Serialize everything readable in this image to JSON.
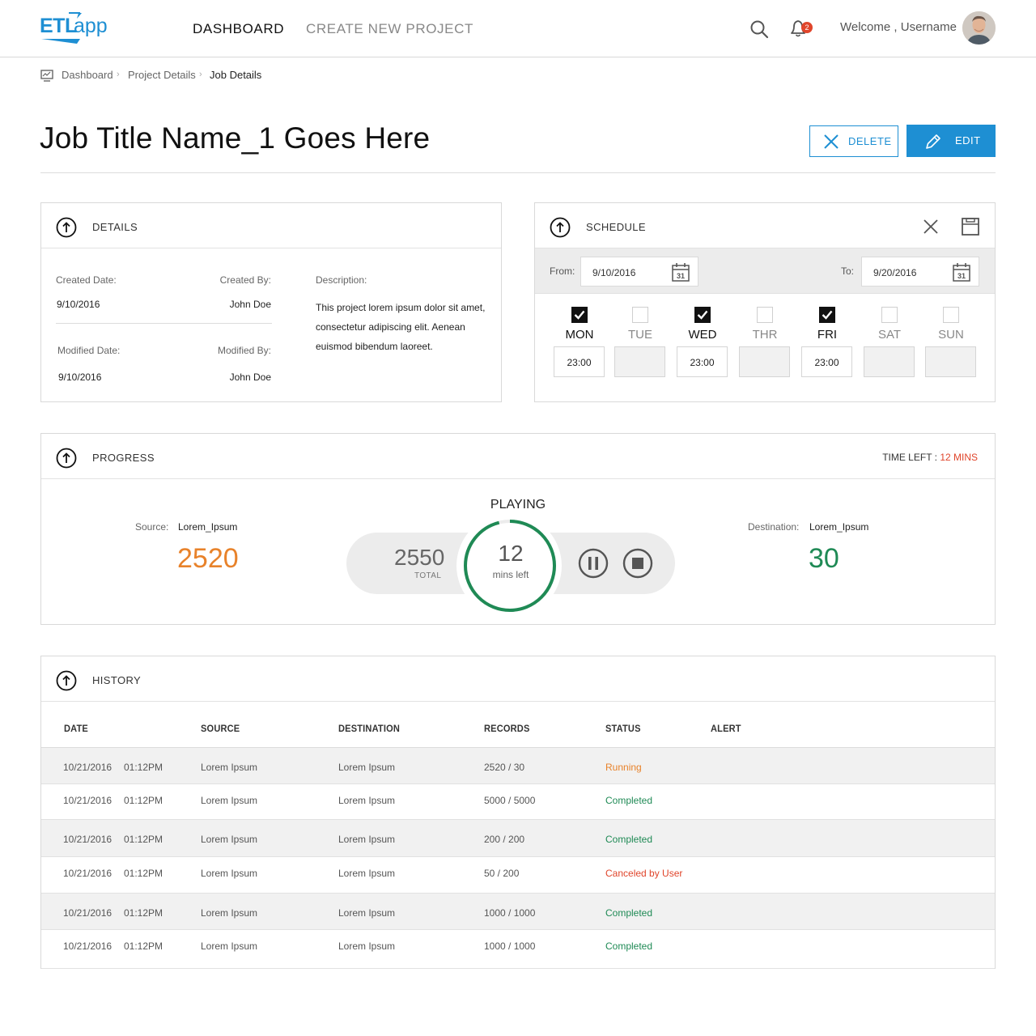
{
  "header": {
    "logo_text_a": "ETL",
    "logo_text_b": "app",
    "nav": [
      {
        "label": "DASHBOARD",
        "active": true
      },
      {
        "label": "CREATE NEW PROJECT",
        "active": false
      }
    ],
    "notification_count": "2",
    "welcome": "Welcome , Username",
    "icons": {
      "search": "search-icon",
      "bell": "bell-icon",
      "avatar": "user-avatar"
    }
  },
  "breadcrumb": {
    "items": [
      "Dashboard",
      "Project Details",
      "Job Details"
    ],
    "separator": "›"
  },
  "page": {
    "title": "Job Title Name_1 Goes Here",
    "delete_label": "DELETE",
    "edit_label": "EDIT"
  },
  "details": {
    "title": "DETAILS",
    "created_date_label": "Created Date:",
    "created_date": "9/10/2016",
    "created_by_label": "Created By:",
    "created_by": "John Doe",
    "modified_date_label": "Modified Date:",
    "modified_date": "9/10/2016",
    "modified_by_label": "Modified By:",
    "modified_by": "John Doe",
    "description_label": "Description:",
    "description": "This project lorem ipsum dolor sit amet, consectetur adipiscing elit. Aenean euismod bibendum laoreet."
  },
  "schedule": {
    "title": "SCHEDULE",
    "from_label": "From:",
    "from_value": "9/10/2016",
    "to_label": "To:",
    "to_value": "9/20/2016",
    "calendar_day": "31",
    "days": [
      {
        "name": "MON",
        "checked": true,
        "time": "23:00"
      },
      {
        "name": "TUE",
        "checked": false,
        "time": ""
      },
      {
        "name": "WED",
        "checked": true,
        "time": "23:00"
      },
      {
        "name": "THR",
        "checked": false,
        "time": ""
      },
      {
        "name": "FRI",
        "checked": true,
        "time": "23:00"
      },
      {
        "name": "SAT",
        "checked": false,
        "time": ""
      },
      {
        "name": "SUN",
        "checked": false,
        "time": ""
      }
    ]
  },
  "progress": {
    "title": "PROGRESS",
    "time_left_label": "TIME LEFT : ",
    "time_left_value": "12 MINS",
    "state": "PLAYING",
    "source_label": "Source:",
    "source_name": "Lorem_Ipsum",
    "source_count": "2520",
    "destination_label": "Destination:",
    "destination_name": "Lorem_Ipsum",
    "destination_count": "30",
    "total": "2550",
    "total_label": "TOTAL",
    "minutes_left": "12",
    "minutes_left_label": "mins left",
    "ring_fraction": 0.96,
    "colors": {
      "source": "#e8822a",
      "destination": "#1f8a55",
      "ring": "#1f8a55",
      "accent": "#1e8fd3",
      "alert": "#e0452b"
    }
  },
  "history": {
    "title": "HISTORY",
    "columns": [
      "DATE",
      "SOURCE",
      "DESTINATION",
      "RECORDS",
      "STATUS",
      "ALERT"
    ],
    "rows": [
      {
        "date": "10/21/2016",
        "time": "01:12PM",
        "source": "Lorem Ipsum",
        "destination": "Lorem Ipsum",
        "records": "2520 / 30",
        "status": "Running",
        "status_type": "running",
        "alert": ""
      },
      {
        "date": "10/21/2016",
        "time": "01:12PM",
        "source": "Lorem Ipsum",
        "destination": "Lorem Ipsum",
        "records": "5000 / 5000",
        "status": "Completed",
        "status_type": "completed",
        "alert": ""
      },
      {
        "date": "10/21/2016",
        "time": "01:12PM",
        "source": "Lorem Ipsum",
        "destination": "Lorem Ipsum",
        "records": "200 / 200",
        "status": "Completed",
        "status_type": "completed",
        "alert": ""
      },
      {
        "date": "10/21/2016",
        "time": "01:12PM",
        "source": "Lorem Ipsum",
        "destination": "Lorem Ipsum",
        "records": "50 / 200",
        "status": "Canceled by User",
        "status_type": "canceled",
        "alert": ""
      },
      {
        "date": "10/21/2016",
        "time": "01:12PM",
        "source": "Lorem Ipsum",
        "destination": "Lorem Ipsum",
        "records": "1000 / 1000",
        "status": "Completed",
        "status_type": "completed",
        "alert": ""
      },
      {
        "date": "10/21/2016",
        "time": "01:12PM",
        "source": "Lorem Ipsum",
        "destination": "Lorem Ipsum",
        "records": "1000 / 1000",
        "status": "Completed",
        "status_type": "completed",
        "alert": ""
      }
    ]
  }
}
